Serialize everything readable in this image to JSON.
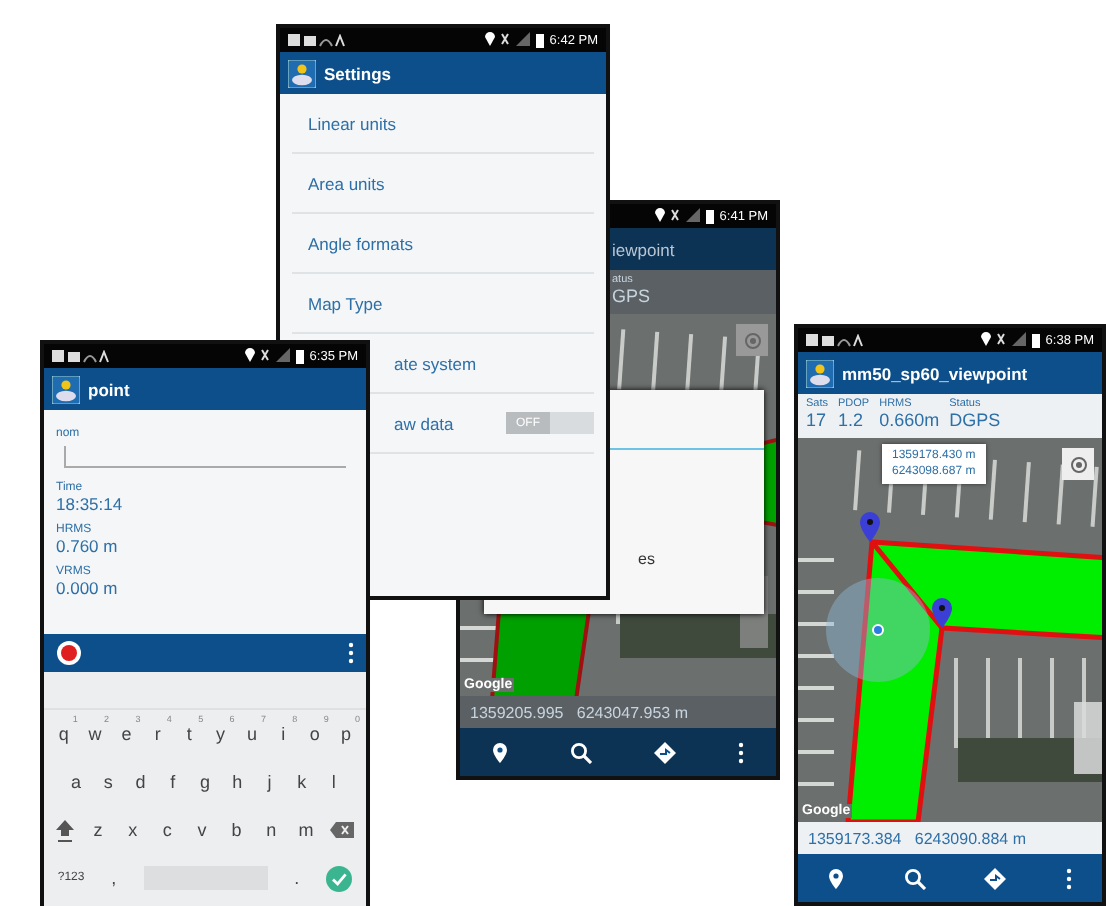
{
  "settings_screen": {
    "status_bar": {
      "time": "6:42 PM"
    },
    "title": "Settings",
    "items": [
      {
        "kind": "link",
        "label": "Linear units"
      },
      {
        "kind": "link",
        "label": "Area units"
      },
      {
        "kind": "link",
        "label": "Angle formats"
      },
      {
        "kind": "link",
        "label": "Map Type"
      },
      {
        "kind": "link",
        "label": "ate system"
      },
      {
        "kind": "toggle",
        "label": "aw data",
        "on": false,
        "state_label": "OFF"
      }
    ]
  },
  "map_screen_back": {
    "status_bar": {
      "time": "6:41 PM"
    },
    "title": "iewpoint",
    "info": [
      {
        "label": "atus",
        "value": "GPS"
      }
    ],
    "dialog_items": [
      {
        "label": "es"
      }
    ],
    "map_attribution": "Google",
    "coordinates": "1359205.995   6243047.953 m"
  },
  "point_screen": {
    "status_bar": {
      "time": "6:35 PM"
    },
    "title": "point",
    "fields": [
      {
        "kind": "input",
        "label": "nom"
      },
      {
        "kind": "reading",
        "label": "Time",
        "value": "18:35:14"
      },
      {
        "kind": "reading",
        "label": "HRMS",
        "value": "0.760 m"
      },
      {
        "kind": "reading",
        "label": "VRMS",
        "value": "0.000 m"
      }
    ],
    "keyboard": [
      [
        {
          "kind": "char",
          "label": "q",
          "hint": "1"
        },
        {
          "kind": "char",
          "label": "w",
          "hint": "2"
        },
        {
          "kind": "char",
          "label": "e",
          "hint": "3"
        },
        {
          "kind": "char",
          "label": "r",
          "hint": "4"
        },
        {
          "kind": "char",
          "label": "t",
          "hint": "5"
        },
        {
          "kind": "char",
          "label": "y",
          "hint": "6"
        },
        {
          "kind": "char",
          "label": "u",
          "hint": "7"
        },
        {
          "kind": "char",
          "label": "i",
          "hint": "8"
        },
        {
          "kind": "char",
          "label": "o",
          "hint": "9"
        },
        {
          "kind": "char",
          "label": "p",
          "hint": "0"
        }
      ],
      [
        {
          "kind": "char",
          "label": "a"
        },
        {
          "kind": "char",
          "label": "s"
        },
        {
          "kind": "char",
          "label": "d"
        },
        {
          "kind": "char",
          "label": "f"
        },
        {
          "kind": "char",
          "label": "g"
        },
        {
          "kind": "char",
          "label": "h"
        },
        {
          "kind": "char",
          "label": "j"
        },
        {
          "kind": "char",
          "label": "k"
        },
        {
          "kind": "char",
          "label": "l"
        }
      ],
      [
        {
          "kind": "shift"
        },
        {
          "kind": "char",
          "label": "z"
        },
        {
          "kind": "char",
          "label": "x"
        },
        {
          "kind": "char",
          "label": "c"
        },
        {
          "kind": "char",
          "label": "v"
        },
        {
          "kind": "char",
          "label": "b"
        },
        {
          "kind": "char",
          "label": "n"
        },
        {
          "kind": "char",
          "label": "m"
        },
        {
          "kind": "backspace"
        }
      ],
      [
        {
          "kind": "char",
          "label": "?123"
        },
        {
          "kind": "char",
          "label": ","
        },
        {
          "kind": "space"
        },
        {
          "kind": "char",
          "label": "."
        },
        {
          "kind": "enter"
        }
      ]
    ]
  },
  "map_screen_front": {
    "status_bar": {
      "time": "6:38 PM"
    },
    "title": "mm50_sp60_viewpoint",
    "info": [
      {
        "label": "Sats",
        "value": "17"
      },
      {
        "label": "PDOP",
        "value": "1.2"
      },
      {
        "label": "HRMS",
        "value": "0.660m"
      },
      {
        "label": "Status",
        "value": "DGPS"
      }
    ],
    "callout": [
      "1359178.430 m",
      "6243098.687 m"
    ],
    "map_attribution": "Google",
    "coordinates": "1359173.384   6243090.884 m"
  }
}
